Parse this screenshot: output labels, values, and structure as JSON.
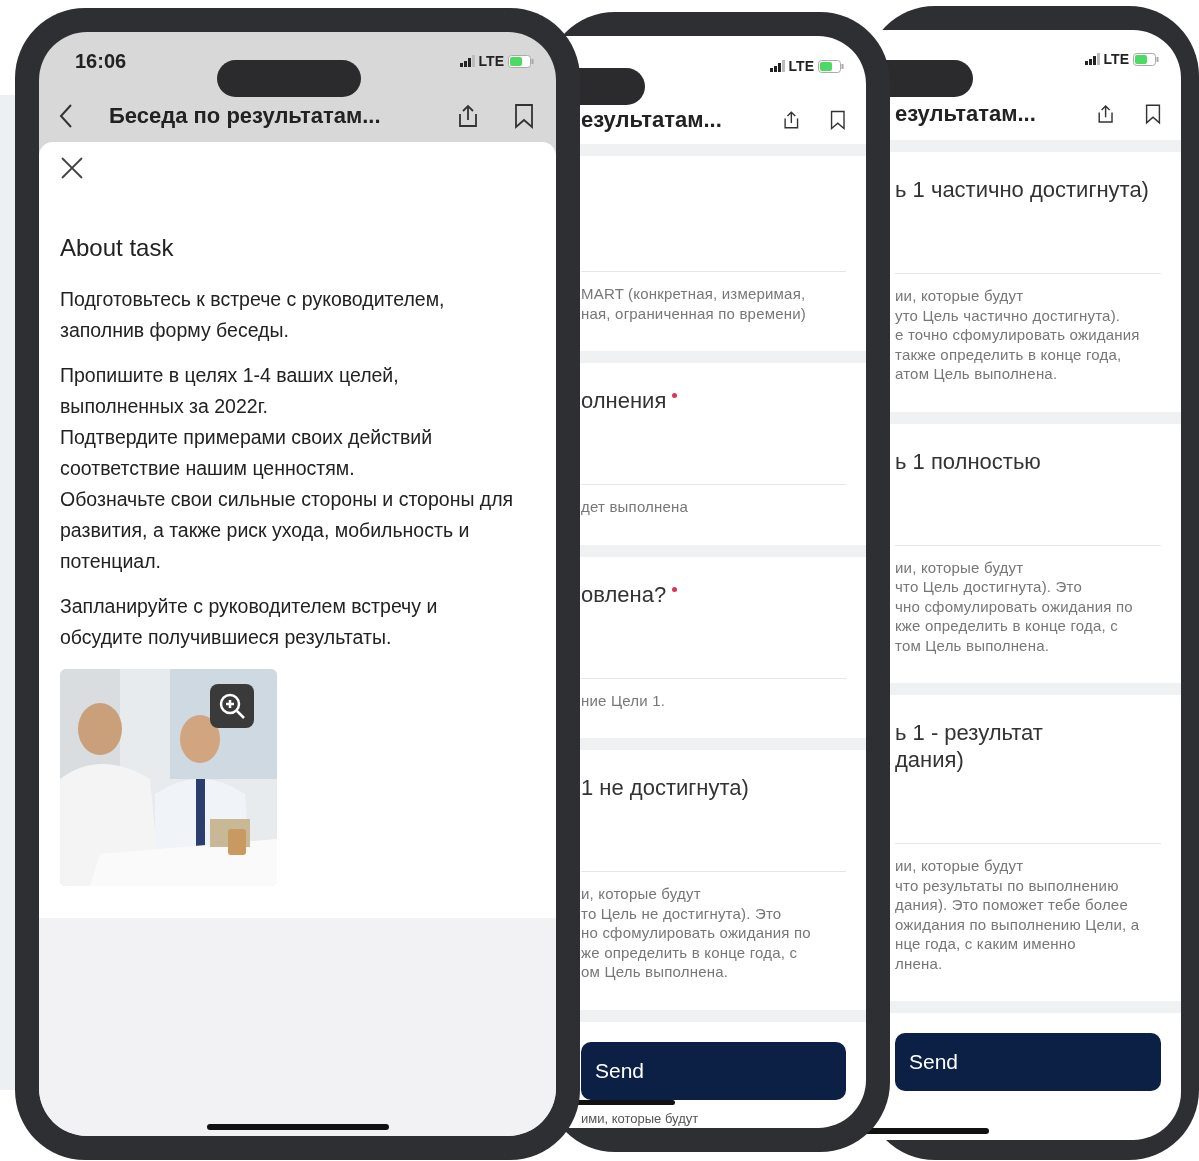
{
  "phones": [
    {
      "kind": "task_sheet",
      "status": {
        "time": "16:06",
        "network": "LTE"
      },
      "header": {
        "title": "Беседа по результатам..."
      },
      "sheet": {
        "heading": "About task",
        "paragraphs": [
          [
            "Подготовьтесь к встрече с руководителем, заполнив форму беседы."
          ],
          [
            "Пропишите в целях 1-4 ваших целей, выполненных за 2022г.",
            "Подтвердите примерами своих действий соответствие нашим ценностям.",
            "Обозначьте свои сильные стороны и стороны для развития, а также риск ухода, мобильность и потенциал."
          ],
          [
            "Запланируйте с руководителем встречу и обсудите получившиеся результаты."
          ]
        ],
        "image": {
          "kind": "picture"
        }
      }
    },
    {
      "kind": "form",
      "status": {
        "network": "LTE"
      },
      "header": {
        "title": "езультатам..."
      },
      "sections": [
        {
          "help": "MART (конкретная, измеримая,\nная, ограниченная по времени)"
        },
        {
          "label": "олнения",
          "required": true,
          "help": "дет выполнена"
        },
        {
          "label": "овлена?",
          "required": true,
          "help": "ние Цели 1."
        },
        {
          "label": "1 не достигнута)",
          "required": false,
          "help": "и, которые будут\nто Цель не достигнута). Это\nно сфомулировать ожидания по\nже определить в конце года, с\nом Цель выполнена."
        }
      ],
      "submit": "Send",
      "footer_text": "ими, которые будут"
    },
    {
      "kind": "form",
      "status": {
        "network": "LTE"
      },
      "header": {
        "title": "езультатам..."
      },
      "sections": [
        {
          "label": "ь 1 частично достигнута)",
          "required": false,
          "help": "ии, которые будут\nуто Цель частично достигнута).\nе точно сфомулировать ожидания\nтакже определить в конце года,\nатом Цель выполнена."
        },
        {
          "label": "ь 1 полностью",
          "required": false,
          "help": "ии, которые будут\nчто Цель достигнута). Это\nчно сфомулировать ожидания по\nкже определить в конце года, с\nтом Цель выполнена."
        },
        {
          "label": "ь 1 - результат\nдания)",
          "required": false,
          "help": "ии, которые будут\nчто результаты по выполнению\nдания). Это поможет тебе более\nожидания по выполнению Цели, а\nнце года, с каким именно\nлнена."
        }
      ],
      "submit": "Send"
    }
  ]
}
